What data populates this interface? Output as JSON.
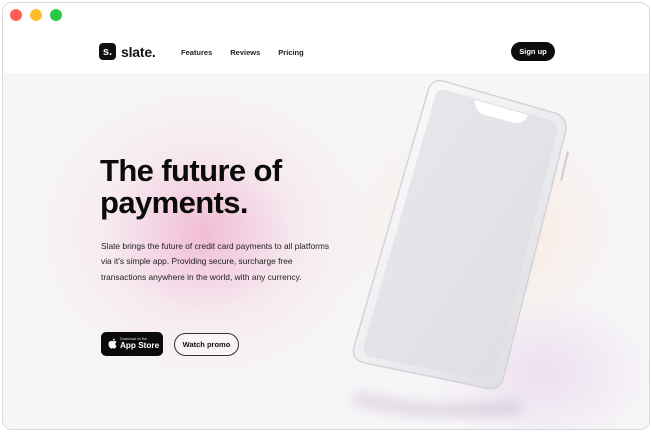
{
  "window": {
    "controls": [
      "close",
      "minimize",
      "zoom"
    ]
  },
  "nav": {
    "logo_mark": "s.",
    "logo_text": "slate.",
    "links": [
      "Features",
      "Reviews",
      "Pricing"
    ],
    "signup_label": "Sign up"
  },
  "hero": {
    "headline_line1": "The future of",
    "headline_line2": "payments.",
    "description": "Slate brings the future of credit card payments to all platforms via it's simple app. Providing secure, surcharge free transactions anywhere in the world, with any currency.",
    "appstore_small": "Download on the",
    "appstore_big": "App Store",
    "promo_label": "Watch promo"
  },
  "colors": {
    "accent": "#0d0d0d",
    "background": "#f6f5f7",
    "glow_pink": "#f0b2cd",
    "glow_peach": "#fce2d0"
  },
  "icons": {
    "store": "apple-icon",
    "device": "phone-mockup"
  }
}
